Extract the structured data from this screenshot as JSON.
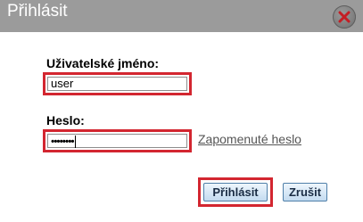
{
  "dialog": {
    "title": "Přihlásit",
    "close_icon": "close-icon"
  },
  "form": {
    "username_label": "Uživatelské jméno:",
    "username_value": "user",
    "password_label": "Heslo:",
    "password_masked": "••••••••",
    "forgot_link": "Zapomenuté heslo"
  },
  "buttons": {
    "login_label": "Přihlásit",
    "cancel_label": "Zrušit"
  },
  "colors": {
    "titlebar": "#9b9b9b",
    "highlight": "#d32630",
    "button_gradient_top": "#eef6fd",
    "button_gradient_bottom": "#c3dbf0"
  }
}
